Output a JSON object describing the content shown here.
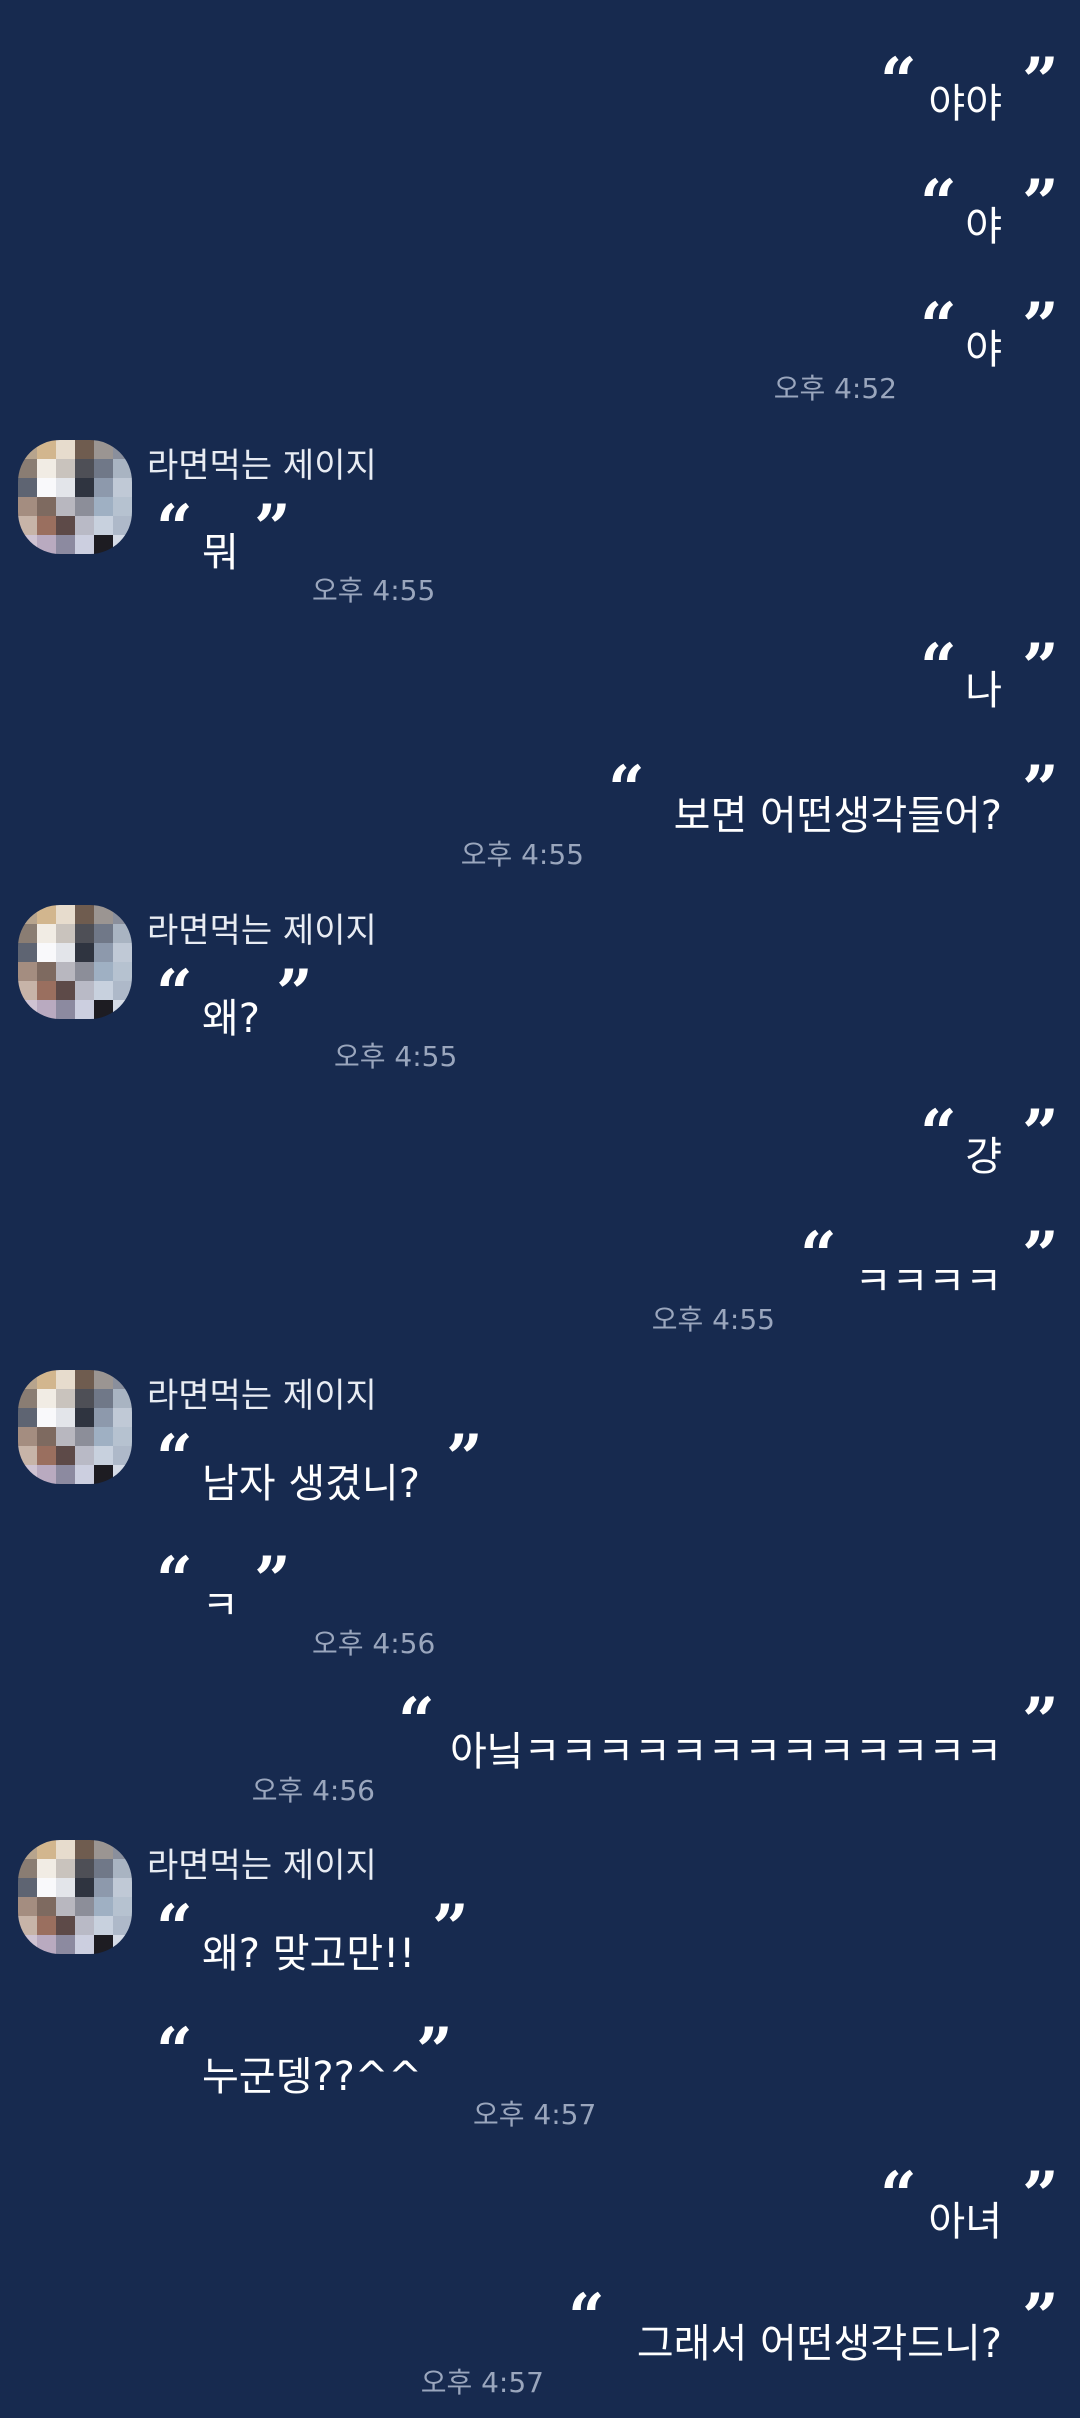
{
  "messages": [
    {
      "side": "right",
      "text": "야야"
    },
    {
      "side": "right",
      "text": "야"
    },
    {
      "side": "right",
      "text": "야",
      "time": "오후 4:52"
    },
    {
      "side": "left",
      "sender": "라면먹는 제이지",
      "text": "뭐",
      "time": "오후 4:55"
    },
    {
      "side": "right",
      "text": "나"
    },
    {
      "side": "right",
      "text": "보면 어떤생각들어?",
      "time": "오후 4:55"
    },
    {
      "side": "left",
      "sender": "라면먹는 제이지",
      "text": "왜?",
      "time": "오후 4:55"
    },
    {
      "side": "right",
      "text": "걍"
    },
    {
      "side": "right",
      "text": "ㅋㅋㅋㅋ",
      "time": "오후 4:55"
    },
    {
      "side": "left",
      "sender": "라면먹는 제이지",
      "text": "남자 생겼니?"
    },
    {
      "side": "left",
      "text": "ㅋ",
      "time": "오후 4:56"
    },
    {
      "side": "right",
      "text": "아닠ㅋㅋㅋㅋㅋㅋㅋㅋㅋㅋㅋㅋㅋ",
      "time": "오후 4:56"
    },
    {
      "side": "left",
      "sender": "라면먹는 제이지",
      "text": "왜? 맞고만!!"
    },
    {
      "side": "left",
      "text": "누군뎅??^^",
      "time": "오후 4:57"
    },
    {
      "side": "right",
      "text": "아녀"
    },
    {
      "side": "right",
      "text": "그래서 어떤생각드니?",
      "time": "오후 4:57"
    }
  ],
  "glyphs": {
    "open_quote": "“",
    "close_quote": "”"
  },
  "colors": {
    "background": "#172a4f",
    "timestamp": "#9aa6bd",
    "text": "#ffffff"
  }
}
